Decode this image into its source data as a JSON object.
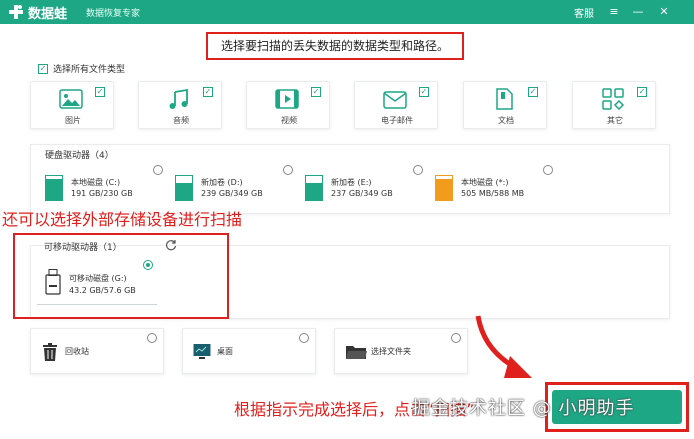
{
  "titlebar": {
    "app_title": "数据蛙",
    "app_subtitle": "数据恢复专家",
    "service_label": "客服",
    "menu_glyph": "≡",
    "minimize_glyph": "—",
    "close_glyph": "✕",
    "color": "#1ea785"
  },
  "instruction": "选择要扫描的丢失数据的数据类型和路径。",
  "select_all": {
    "label": "选择所有文件类型",
    "checked": true
  },
  "file_types": [
    {
      "label": "图片",
      "icon": "image-icon",
      "checked": true
    },
    {
      "label": "音频",
      "icon": "audio-icon",
      "checked": true
    },
    {
      "label": "视频",
      "icon": "video-icon",
      "checked": true
    },
    {
      "label": "电子邮件",
      "icon": "email-icon",
      "checked": true
    },
    {
      "label": "文档",
      "icon": "document-icon",
      "checked": true
    },
    {
      "label": "其它",
      "icon": "other-icon",
      "checked": true
    }
  ],
  "hard_disks": {
    "title": "硬盘驱动器（4）",
    "drives": [
      {
        "name": "本地磁盘 (C:)",
        "size": "191 GB/230 GB",
        "used_fraction": 0.83,
        "color": "#1ea785"
      },
      {
        "name": "新加卷 (D:)",
        "size": "239 GB/349 GB",
        "used_fraction": 0.68,
        "color": "#1ea785"
      },
      {
        "name": "新加卷 (E:)",
        "size": "237 GB/349 GB",
        "used_fraction": 0.68,
        "color": "#1ea785"
      },
      {
        "name": "本地磁盘 (*:)",
        "size": "505 MB/588 MB",
        "used_fraction": 0.86,
        "color": "#f29b1d"
      }
    ]
  },
  "removable": {
    "title": "可移动驱动器（1）",
    "drive": {
      "name": "可移动磁盘 (G:)",
      "size": "43.2 GB/57.6 GB",
      "selected": true
    }
  },
  "locations": [
    {
      "label": "回收站",
      "icon": "recycle-bin-icon"
    },
    {
      "label": "桌面",
      "icon": "desktop-icon"
    },
    {
      "label": "选择文件夹",
      "icon": "folder-icon"
    }
  ],
  "annotations": {
    "external": "还可以选择外部存储设备进行扫描",
    "scan_hint": "根据指示完成选择后，点击“扫描”"
  },
  "watermark": "掘金技术社区 @ 小明助手"
}
